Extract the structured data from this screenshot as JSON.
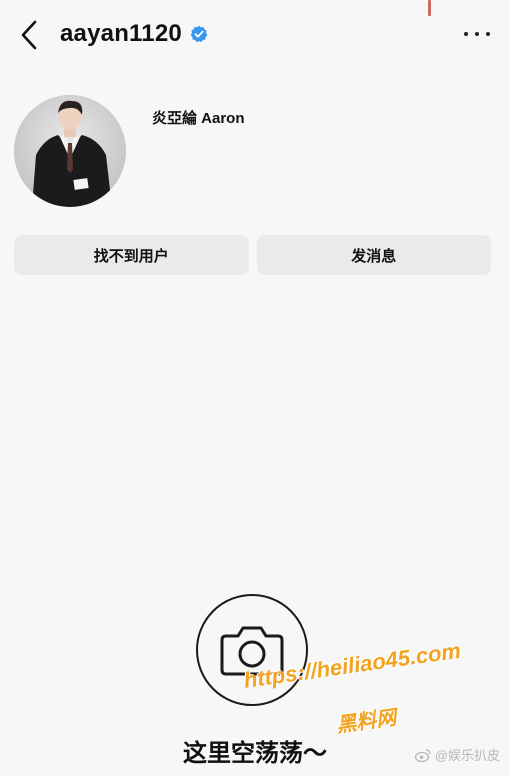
{
  "header": {
    "username": "aayan1120",
    "back_icon": "chevron-left-icon",
    "verified_icon": "verified-badge-icon",
    "more_icon": "more-horizontal-icon"
  },
  "profile": {
    "display_name": "炎亞綸 Aaron"
  },
  "actions": {
    "not_found_label": "找不到用户",
    "message_label": "发消息"
  },
  "empty_state": {
    "icon": "camera-icon",
    "text": "这里空荡荡～"
  },
  "watermarks": {
    "url": "https://heiliao45.com",
    "brand": "黑料网",
    "weibo": "@娱乐扒皮"
  },
  "colors": {
    "verified": "#3897f0",
    "watermark": "#f2a31f",
    "button_bg": "#e9eaec"
  }
}
